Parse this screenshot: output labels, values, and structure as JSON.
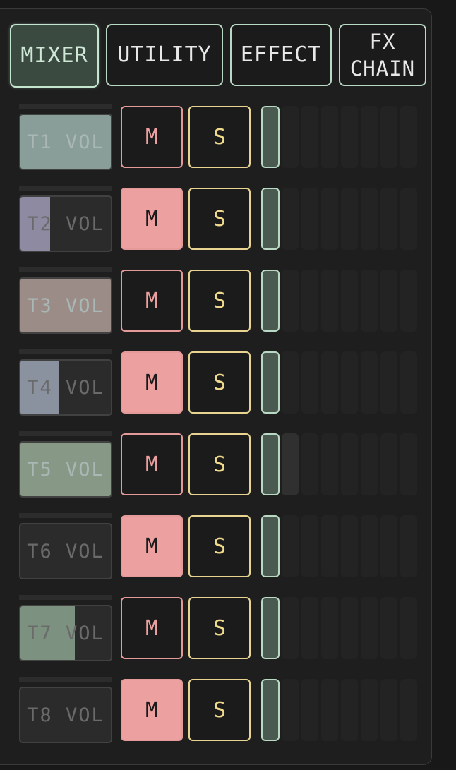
{
  "tabs": [
    {
      "label": "MIXER",
      "active": true
    },
    {
      "label": "UTILITY",
      "active": false
    },
    {
      "label": "EFFECT",
      "active": false
    },
    {
      "label": "FX\nCHAIN",
      "active": false
    }
  ],
  "colors": {
    "accent": "#b9d9c5",
    "mute": "#eca0a0",
    "solo": "#f0da8c",
    "panel": "#1e1e1e"
  },
  "tracks": [
    {
      "vol_label": "T1 VOL",
      "volume": 1.0,
      "fill_color": "#8a9e99",
      "mute_label": "M",
      "muted": false,
      "solo_label": "S",
      "meter_level": 0
    },
    {
      "vol_label": "T2 VOL",
      "volume": 0.33,
      "fill_color": "#8e8aa1",
      "mute_label": "M",
      "muted": true,
      "solo_label": "S",
      "meter_level": 0
    },
    {
      "vol_label": "T3 VOL",
      "volume": 1.0,
      "fill_color": "#9b8c87",
      "mute_label": "M",
      "muted": false,
      "solo_label": "S",
      "meter_level": 0
    },
    {
      "vol_label": "T4 VOL",
      "volume": 0.42,
      "fill_color": "#8a919f",
      "mute_label": "M",
      "muted": true,
      "solo_label": "S",
      "meter_level": 0
    },
    {
      "vol_label": "T5 VOL",
      "volume": 1.0,
      "fill_color": "#879886",
      "mute_label": "M",
      "muted": false,
      "solo_label": "S",
      "meter_level": 1
    },
    {
      "vol_label": "T6 VOL",
      "volume": 0.0,
      "fill_color": "#879886",
      "mute_label": "M",
      "muted": true,
      "solo_label": "S",
      "meter_level": 0
    },
    {
      "vol_label": "T7 VOL",
      "volume": 0.6,
      "fill_color": "#7c9180",
      "mute_label": "M",
      "muted": false,
      "solo_label": "S",
      "meter_level": 0
    },
    {
      "vol_label": "T8 VOL",
      "volume": 0.0,
      "fill_color": "#879886",
      "mute_label": "M",
      "muted": true,
      "solo_label": "S",
      "meter_level": 0
    }
  ]
}
